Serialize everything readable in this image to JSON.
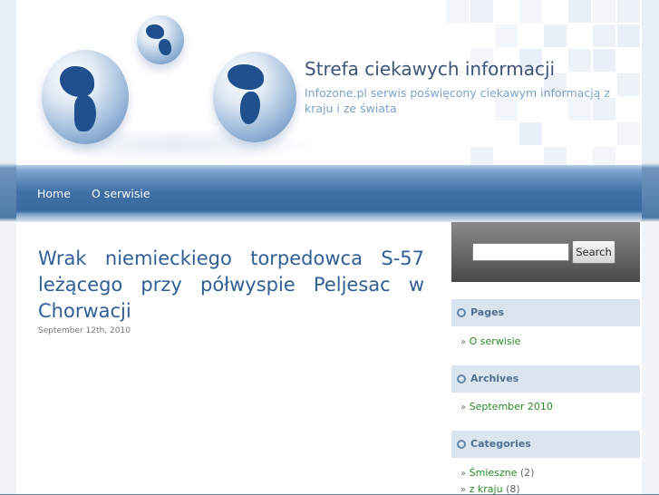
{
  "header": {
    "site_title": "Strefa ciekawych informacji",
    "site_description": "Infozone.pl serwis poświęcony ciekawym informacją z kraju i ze świata"
  },
  "nav": {
    "items": [
      {
        "label": "Home"
      },
      {
        "label": "O serwisie"
      }
    ]
  },
  "post": {
    "title": "Wrak niemieckiego torpedowca S-57 leżącego przy półwyspie Peljesac w Chorwacji",
    "date": "September 12th, 2010"
  },
  "search": {
    "placeholder": "",
    "button_label": "Search"
  },
  "sidebar": {
    "pages": {
      "heading": "Pages",
      "items": [
        {
          "label": "O serwisie"
        }
      ]
    },
    "archives": {
      "heading": "Archives",
      "items": [
        {
          "label": "September 2010"
        }
      ]
    },
    "categories": {
      "heading": "Categories",
      "items": [
        {
          "label": "Śmieszne",
          "count": "(2)"
        },
        {
          "label": "z kraju",
          "count": "(8)"
        }
      ]
    }
  },
  "colors": {
    "title": "#3e5577",
    "description": "#7da3c9",
    "post_title": "#2f5f95",
    "nav_bar": "#3f6fa5",
    "link_green": "#2a8a2a",
    "widget_head": "#dbe5ef"
  }
}
